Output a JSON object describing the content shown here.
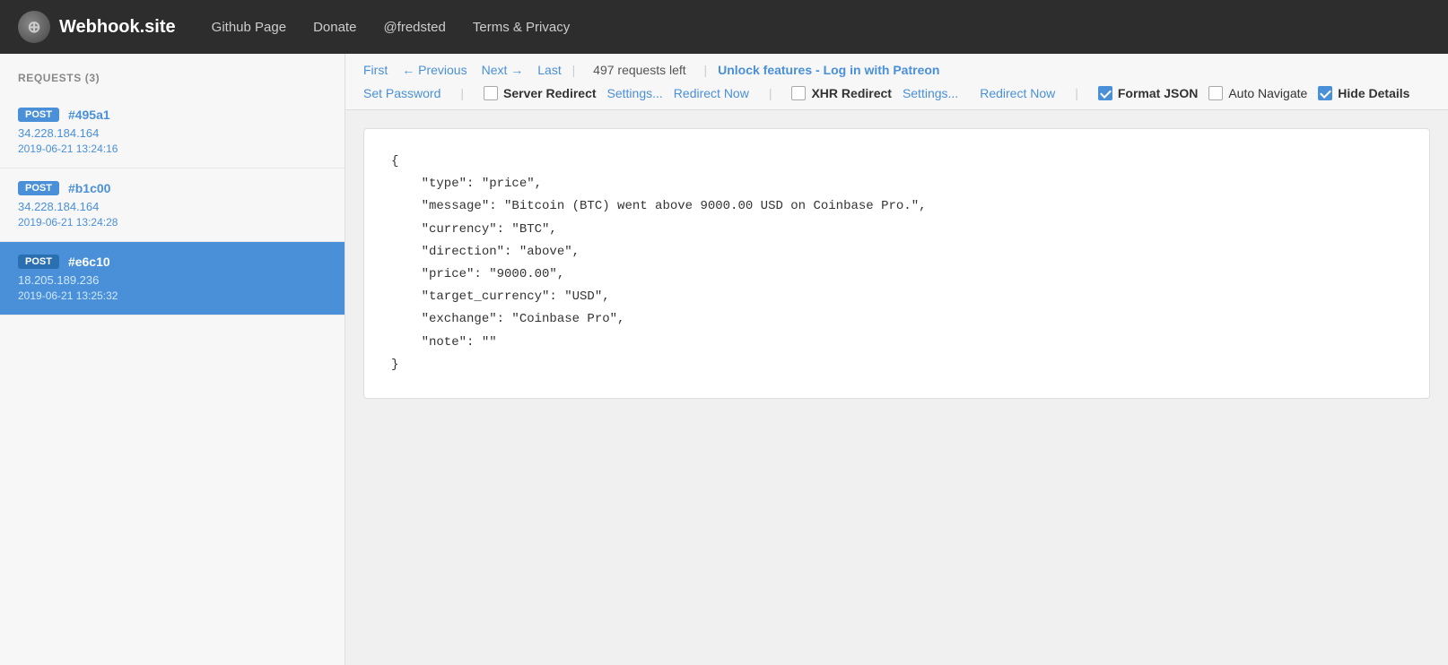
{
  "topnav": {
    "logo_text": "Webhook.site",
    "links": [
      {
        "label": "Github Page",
        "id": "github"
      },
      {
        "label": "Donate",
        "id": "donate"
      },
      {
        "label": "@fredsted",
        "id": "fredsted"
      },
      {
        "label": "Terms & Privacy",
        "id": "terms"
      }
    ]
  },
  "sidebar": {
    "title": "REQUESTS (3)",
    "requests": [
      {
        "method": "POST",
        "id": "#495a1",
        "ip": "34.228.184.164",
        "time": "2019-06-21 13:24:16",
        "active": false
      },
      {
        "method": "POST",
        "id": "#b1c00",
        "ip": "34.228.184.164",
        "time": "2019-06-21 13:24:28",
        "active": false
      },
      {
        "method": "POST",
        "id": "#e6c10",
        "ip": "18.205.189.236",
        "time": "2019-06-21 13:25:32",
        "active": true
      }
    ]
  },
  "toolbar": {
    "nav": {
      "first": "First",
      "previous": "← Previous",
      "next": "Next →",
      "last": "Last"
    },
    "requests_left": "497 requests left",
    "unlock_label": "Unlock features - Log in with Patreon",
    "set_password": "Set Password",
    "server_redirect_label": "Server Redirect",
    "settings1": "Settings...",
    "redirect_now1": "Redirect Now",
    "xhr_redirect_label": "XHR Redirect",
    "settings2": "Settings...",
    "redirect_now2": "Redirect Now",
    "format_json_label": "Format JSON",
    "auto_navigate_label": "Auto Navigate",
    "hide_details_label": "Hide Details",
    "format_json_checked": true,
    "auto_navigate_checked": false,
    "hide_details_checked": true,
    "server_redirect_checked": false,
    "xhr_redirect_checked": false
  },
  "json_content": "{\n    \"type\": \"price\",\n    \"message\": \"Bitcoin (BTC) went above 9000.00 USD on Coinbase Pro.\",\n    \"currency\": \"BTC\",\n    \"direction\": \"above\",\n    \"price\": \"9000.00\",\n    \"target_currency\": \"USD\",\n    \"exchange\": \"Coinbase Pro\",\n    \"note\": \"\"\n}"
}
